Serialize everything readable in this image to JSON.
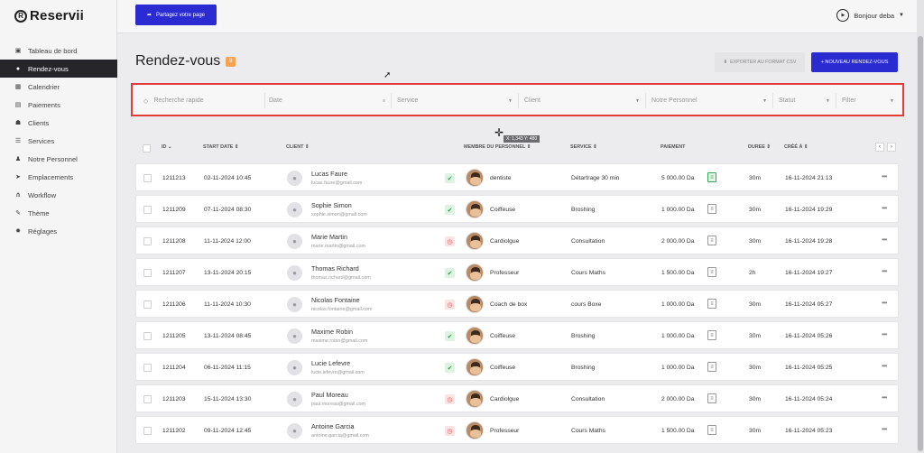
{
  "app": {
    "logo_letter": "R",
    "name": "Reservii"
  },
  "sidebar": {
    "items": [
      {
        "label": "Tableau de bord",
        "icon": "dashboard-icon",
        "active": false
      },
      {
        "label": "Rendez-vous",
        "icon": "clock-icon",
        "active": true
      },
      {
        "label": "Calendrier",
        "icon": "calendar-icon",
        "active": false
      },
      {
        "label": "Paiements",
        "icon": "payment-icon",
        "active": false
      },
      {
        "label": "Clients",
        "icon": "users-icon",
        "active": false
      },
      {
        "label": "Services",
        "icon": "list-icon",
        "active": false
      },
      {
        "label": "Notre Personnel",
        "icon": "staff-icon",
        "active": false
      },
      {
        "label": "Emplacements",
        "icon": "location-icon",
        "active": false
      },
      {
        "label": "Workflow",
        "icon": "workflow-icon",
        "active": false
      },
      {
        "label": "Thème",
        "icon": "brush-icon",
        "active": false
      },
      {
        "label": "Réglages",
        "icon": "gear-icon",
        "active": false
      }
    ]
  },
  "topbar": {
    "share_label": "Partagez votre page",
    "greeting": "Bonjour deba"
  },
  "page": {
    "title": "Rendez-vous",
    "count": "9",
    "csv_label": "EXPORTER AU FORMAT CSV",
    "new_label": "+ NOUVEAU RENDEZ-VOUS"
  },
  "filters": {
    "search_placeholder": "Recherche rapide",
    "date": "Date",
    "service": "Service",
    "client": "Client",
    "staff": "Notre Personnel",
    "status": "Statut",
    "filter": "Filter"
  },
  "cursor_tip": "X: 1,343 Y: 480",
  "table": {
    "headers": {
      "id": "ID",
      "start": "START DATE",
      "client": "CLIENT",
      "staff": "MEMBRE DU PERSONNEL",
      "service": "SERVICE",
      "payment": "PAIEMENT",
      "duration": "DUREE",
      "created": "CRÉÉ À"
    },
    "rows": [
      {
        "id": "1211213",
        "start": "02-11-2024 10:45",
        "name": "Lucas Faure",
        "email": "lucas.faure@gmail.com",
        "status": "ok",
        "staff": "dentiste",
        "service": "Détartrage 30 min",
        "payment": "5 000.00 Da",
        "paid": true,
        "duration": "30m",
        "created": "16-11-2024 21:13"
      },
      {
        "id": "1211209",
        "start": "07-11-2024 08:30",
        "name": "Sophie Simon",
        "email": "sophie.simon@gmail.com",
        "status": "ok",
        "staff": "Coiffeuse",
        "service": "Broshing",
        "payment": "1 000.00 Da",
        "paid": false,
        "duration": "30m",
        "created": "16-11-2024 19:29"
      },
      {
        "id": "1211208",
        "start": "11-11-2024 12:00",
        "name": "Marie Martin",
        "email": "marie.martin@gmail.com",
        "status": "wait",
        "staff": "Cardiolgue",
        "service": "Consultation",
        "payment": "2 000.00 Da",
        "paid": false,
        "duration": "30m",
        "created": "16-11-2024 19:28"
      },
      {
        "id": "1211207",
        "start": "13-11-2024 20:15",
        "name": "Thomas Richard",
        "email": "thomas.richard@gmail.com",
        "status": "ok",
        "staff": "Professeur",
        "service": "Cours Maths",
        "payment": "1 500.00 Da",
        "paid": false,
        "duration": "2h",
        "created": "16-11-2024 19:27"
      },
      {
        "id": "1211206",
        "start": "11-11-2024 10:30",
        "name": "Nicolas Fontaine",
        "email": "nicolas.fontaine@gmail.com",
        "status": "wait",
        "staff": "Coach de box",
        "service": "cours Boxe",
        "payment": "1 000.00 Da",
        "paid": false,
        "duration": "30m",
        "created": "16-11-2024 05:27"
      },
      {
        "id": "1211205",
        "start": "13-11-2024 08:45",
        "name": "Maxime Robin",
        "email": "maxime.robin@gmail.com",
        "status": "ok",
        "staff": "Coiffeuse",
        "service": "Broshing",
        "payment": "1 000.00 Da",
        "paid": false,
        "duration": "30m",
        "created": "16-11-2024 05:26"
      },
      {
        "id": "1211204",
        "start": "06-11-2024 11:15",
        "name": "Lucie Lefevre",
        "email": "lucie.lefevre@gmail.com",
        "status": "ok",
        "staff": "Coiffeuse",
        "service": "Broshing",
        "payment": "1 000.00 Da",
        "paid": false,
        "duration": "30m",
        "created": "16-11-2024 05:25"
      },
      {
        "id": "1211203",
        "start": "15-11-2024 13:30",
        "name": "Paul Moreau",
        "email": "paul.moreau@gmail.com",
        "status": "wait",
        "staff": "Cardiolgue",
        "service": "Consultation",
        "payment": "2 000.00 Da",
        "paid": false,
        "duration": "30m",
        "created": "16-11-2024 05:24"
      },
      {
        "id": "1211202",
        "start": "09-11-2024 12:45",
        "name": "Antoine Garcia",
        "email": "antoine.garcia@gmail.com",
        "status": "wait",
        "staff": "Professeur",
        "service": "Cours Maths",
        "payment": "1 500.00 Da",
        "paid": false,
        "duration": "30m",
        "created": "16-11-2024 05:23"
      }
    ]
  }
}
